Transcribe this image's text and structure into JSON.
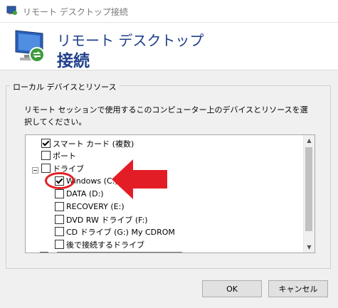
{
  "window": {
    "title": "リモート デスクトップ接続"
  },
  "header": {
    "line1": "リモート デスクトップ",
    "line2": "接続"
  },
  "group": {
    "title": "ローカル デバイスとリソース",
    "description": "リモート セッションで使用するこのコンピューター上のデバイスとリソースを選択してください。"
  },
  "tree": {
    "items": [
      {
        "label": "スマート カード (複数)",
        "checked": true
      },
      {
        "label": "ポート",
        "checked": false
      },
      {
        "label": "ドライブ",
        "checked": false
      },
      {
        "label": "Windows (C:)",
        "checked": true
      },
      {
        "label": "DATA (D:)",
        "checked": false
      },
      {
        "label": "RECOVERY (E:)",
        "checked": false
      },
      {
        "label": "DVD RW ドライブ (F:)",
        "checked": false
      },
      {
        "label": "CD ドライブ (G:) My CDROM",
        "checked": false
      },
      {
        "label": "後で接続するドライブ",
        "checked": false
      }
    ]
  },
  "buttons": {
    "ok": "OK",
    "cancel": "キャンセル"
  },
  "colors": {
    "accent_text": "#1f3f8a",
    "annotation": "#e31d25"
  }
}
